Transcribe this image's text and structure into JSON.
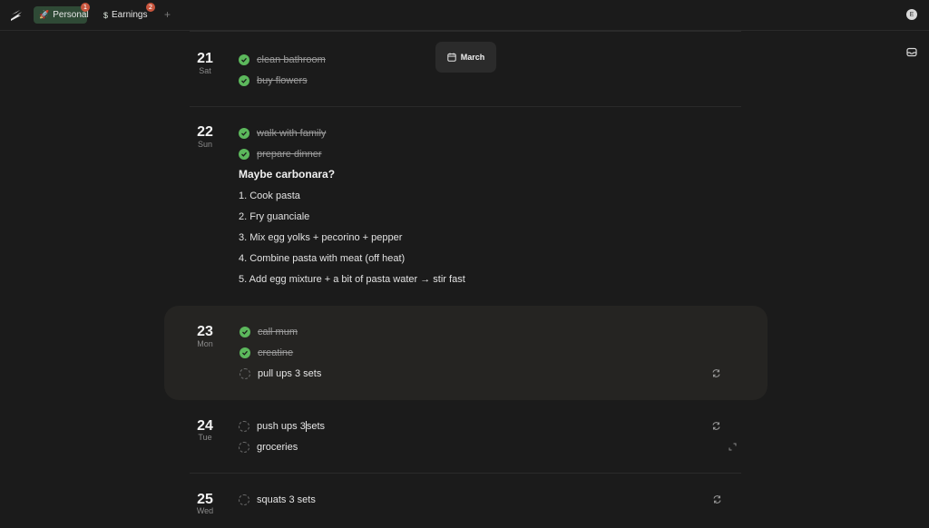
{
  "header": {
    "tabs": [
      {
        "label": "Personal",
        "icon": "rocket-icon",
        "badge": "1"
      },
      {
        "label": "Earnings",
        "icon": "dollar-icon",
        "badge": "2"
      }
    ],
    "avatar_letter": "E"
  },
  "month_button": {
    "label": "March"
  },
  "days": [
    {
      "num": "21",
      "name": "Sat",
      "tasks": [
        {
          "text": "clean bathroom",
          "done": true
        },
        {
          "text": "buy flowers",
          "done": true
        }
      ]
    },
    {
      "num": "22",
      "name": "Sun",
      "tasks": [
        {
          "text": "walk with family",
          "done": true
        },
        {
          "text": "prepare dinner",
          "done": true
        }
      ],
      "note": {
        "heading": "Maybe carbonara?",
        "items": [
          "1.  Cook pasta",
          "2.  Fry guanciale",
          "3.  Mix egg yolks + pecorino + pepper",
          "4.  Combine pasta with meat (off heat)",
          "5.  Add egg mixture + a bit of pasta water → stir fast"
        ]
      }
    },
    {
      "num": "23",
      "name": "Mon",
      "tasks": [
        {
          "text": "call mum",
          "done": true
        },
        {
          "text": "creatine",
          "done": true
        },
        {
          "text": "pull ups 3 sets",
          "done": false
        }
      ]
    },
    {
      "num": "24",
      "name": "Tue",
      "tasks": [
        {
          "text_before_cursor": "push ups 3",
          "text_after_cursor": "sets",
          "done": false
        },
        {
          "text": "groceries",
          "done": false
        }
      ]
    },
    {
      "num": "25",
      "name": "Wed",
      "tasks": [
        {
          "text": "squats 3 sets",
          "done": false
        }
      ]
    }
  ],
  "colors": {
    "background": "#1b1b1b",
    "check_done": "#5cb85c",
    "active_tab": "#2f4a36",
    "badge": "#c8553d",
    "highlight_row": "#252422"
  }
}
